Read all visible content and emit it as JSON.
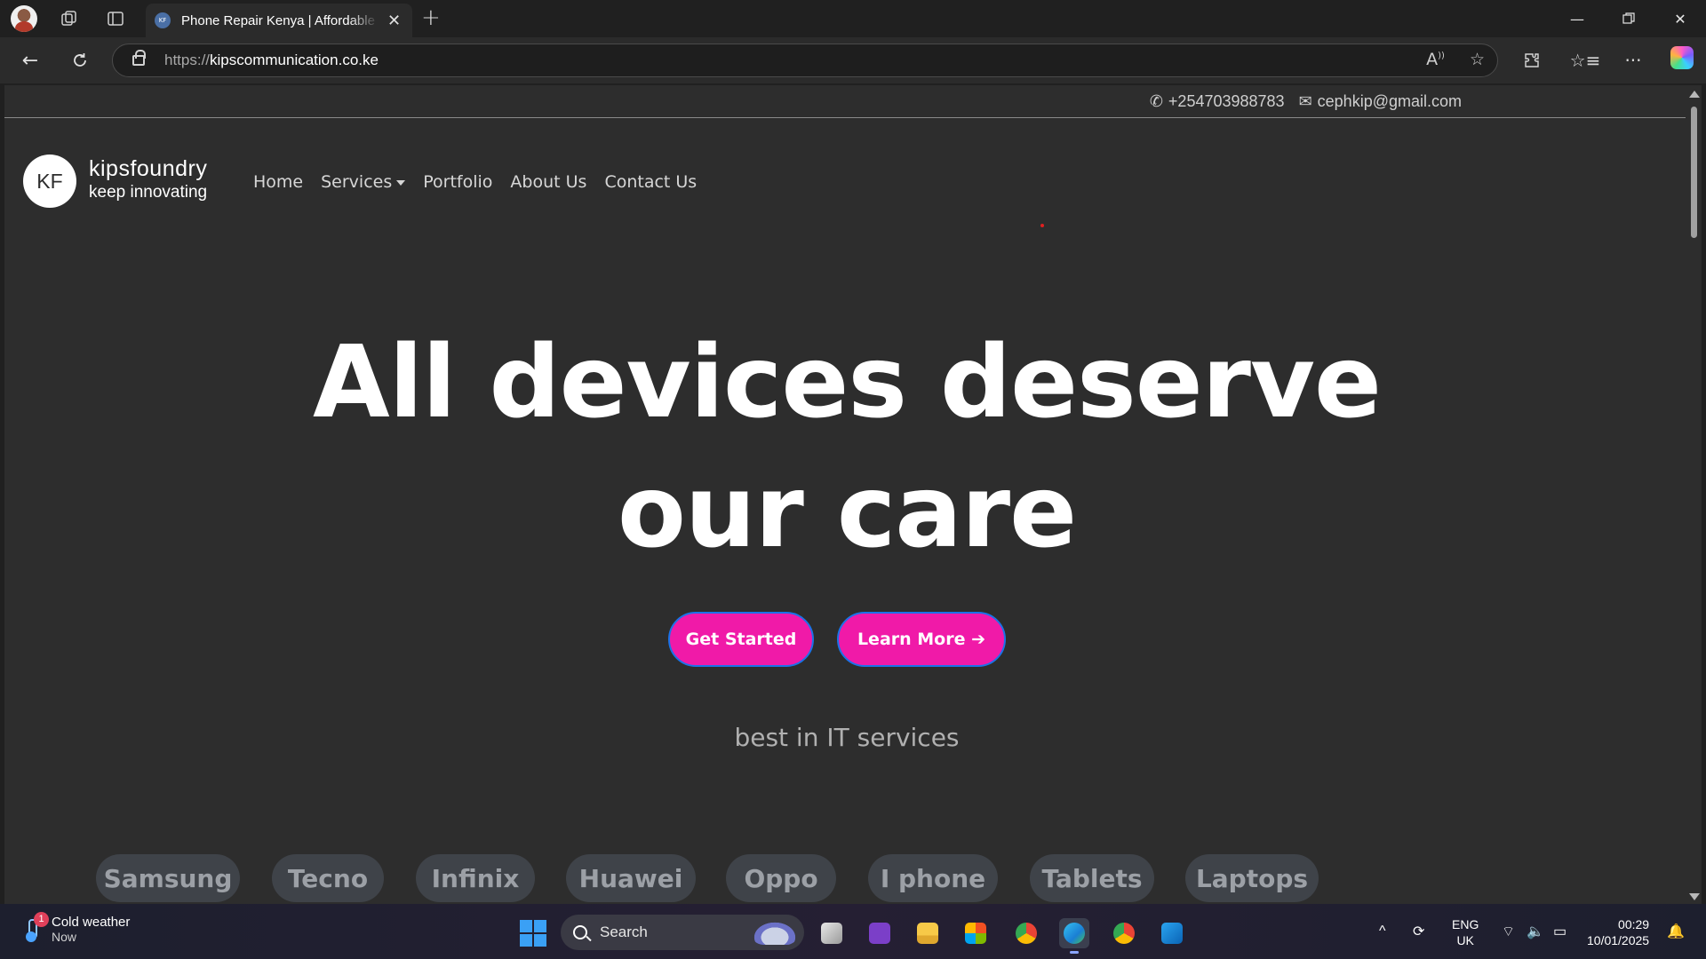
{
  "browser": {
    "tab_title": "Phone Repair Kenya | Affordable & Reliable Repairs",
    "tab_favicon_text": "KF",
    "url_protocol": "https://",
    "url_host": "kipscommunication.co.ke"
  },
  "site": {
    "phone": "+254703988783",
    "email": "cephkip@gmail.com",
    "logo_text": "KF",
    "brand_name": "kipsfoundry",
    "brand_tagline": "keep innovating",
    "nav": [
      "Home",
      "Services",
      "Portfolio",
      "About Us",
      "Contact Us"
    ],
    "hero_line1": "All devices deserve",
    "hero_line2": "our care",
    "btn_get_started": "Get Started",
    "btn_learn_more": "Learn More",
    "subtitle": "best in IT services",
    "device_brands": [
      "Samsung",
      "Tecno",
      "Infinix",
      "Huawei",
      "Oppo",
      "I phone",
      "Tablets",
      "Laptops"
    ],
    "accent_color": "#f01aa8"
  },
  "taskbar": {
    "weather_title": "Cold weather",
    "weather_sub": "Now",
    "weather_badge": "1",
    "search_label": "Search",
    "lang_line1": "ENG",
    "lang_line2": "UK",
    "time": "00:29",
    "date": "10/01/2025"
  }
}
